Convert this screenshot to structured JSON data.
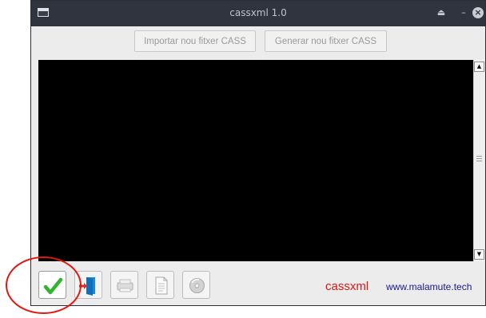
{
  "window": {
    "title": "cassxml 1.0",
    "controls": {
      "eject": "⏏",
      "minimize": "–",
      "close": "×"
    }
  },
  "toolbar_top": {
    "import_label": "Importar nou fitxer CASS",
    "generate_label": "Generar nou fitxer CASS"
  },
  "scrollbar": {
    "up": "▲",
    "down": "▼"
  },
  "bottom_toolbar": {
    "buttons": [
      {
        "icon": "checkmark-icon",
        "enabled": true
      },
      {
        "icon": "exit-door-icon",
        "enabled": true
      },
      {
        "icon": "printer-icon",
        "enabled": false
      },
      {
        "icon": "document-icon",
        "enabled": false
      },
      {
        "icon": "disc-icon",
        "enabled": false
      }
    ]
  },
  "footer": {
    "app_name": "cassxml",
    "website": "www.malamute.tech"
  },
  "colors": {
    "titlebar": "#2f343f",
    "brand": "#e11414",
    "link": "#151b8d",
    "annotation": "#e3170e"
  }
}
